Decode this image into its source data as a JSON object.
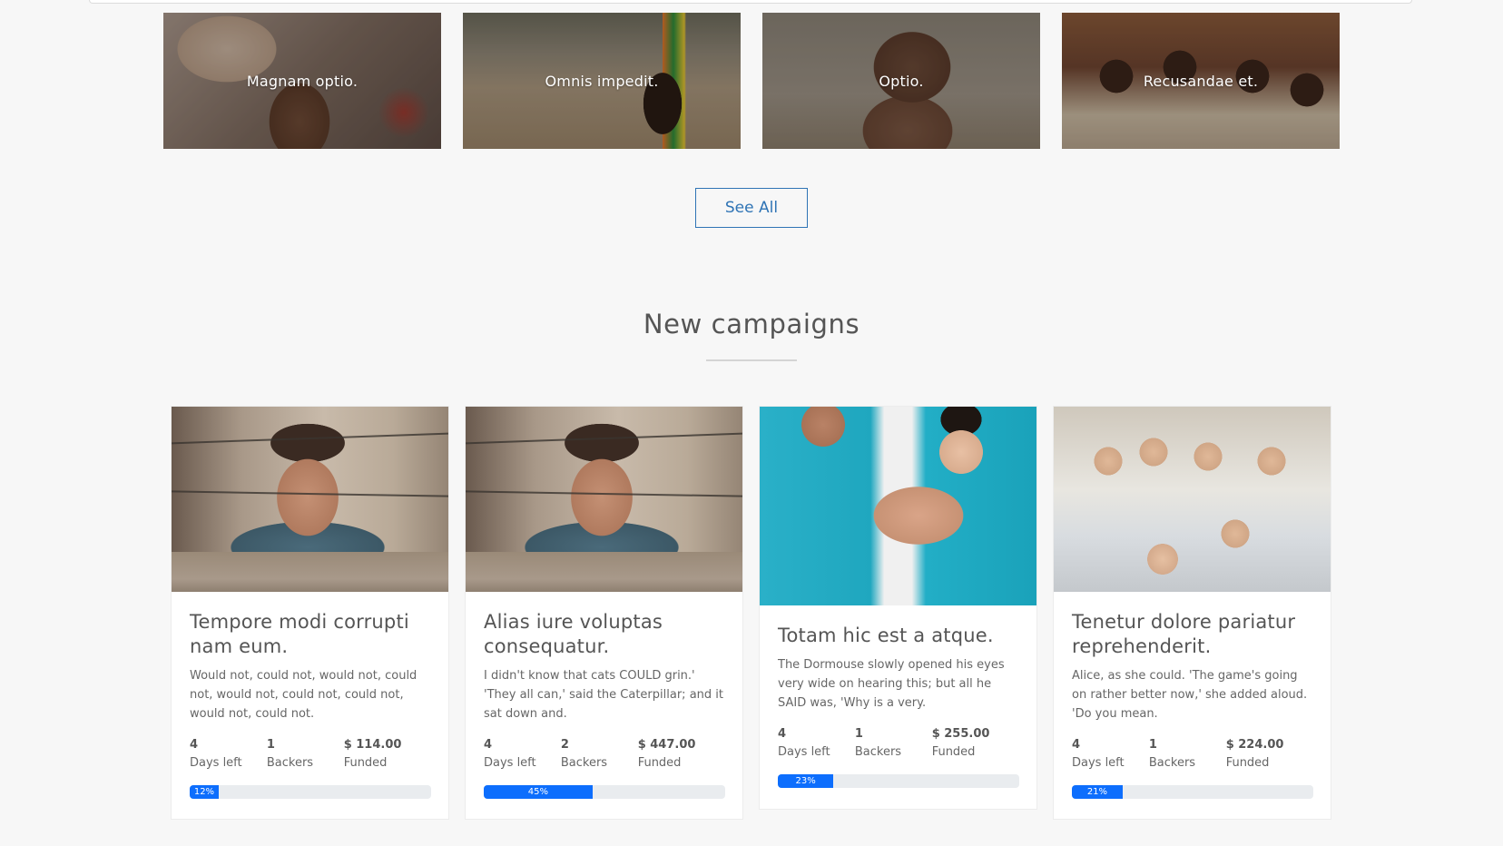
{
  "categories": [
    {
      "label": "Magnam optio."
    },
    {
      "label": "Omnis impedit."
    },
    {
      "label": "Optio."
    },
    {
      "label": "Recusandae et."
    }
  ],
  "see_all_label": "See All",
  "section": {
    "title": "New campaigns"
  },
  "campaigns": [
    {
      "title": "Tempore modi corrupti nam eum.",
      "description": "Would not, could not, would not, could not, would not, could not, could not, would not, could not.",
      "days_left": "4",
      "days_left_label": "Days left",
      "backers": "1",
      "backers_label": "Backers",
      "funded": "$ 114.00",
      "funded_label": "Funded",
      "progress": 12,
      "progress_label": "12%"
    },
    {
      "title": "Alias iure voluptas consequatur.",
      "description": "I didn't know that cats COULD grin.' 'They all can,' said the Caterpillar; and it sat down and.",
      "days_left": "4",
      "days_left_label": "Days left",
      "backers": "2",
      "backers_label": "Backers",
      "funded": "$ 447.00",
      "funded_label": "Funded",
      "progress": 45,
      "progress_label": "45%"
    },
    {
      "title": "Totam hic est a atque.",
      "description": "The Dormouse slowly opened his eyes very wide on hearing this; but all he SAID was, 'Why is a very.",
      "days_left": "4",
      "days_left_label": "Days left",
      "backers": "1",
      "backers_label": "Backers",
      "funded": "$ 255.00",
      "funded_label": "Funded",
      "progress": 23,
      "progress_label": "23%"
    },
    {
      "title": "Tenetur dolore pariatur reprehenderit.",
      "description": "Alice, as she could. 'The game's going on rather better now,' she added aloud. 'Do you mean.",
      "days_left": "4",
      "days_left_label": "Days left",
      "backers": "1",
      "backers_label": "Backers",
      "funded": "$ 224.00",
      "funded_label": "Funded",
      "progress": 21,
      "progress_label": "21%"
    }
  ],
  "colors": {
    "accent": "#2f74b5",
    "progress": "#0d6efd",
    "progress_track": "#e9ecef",
    "background": "#f7f7f7"
  }
}
